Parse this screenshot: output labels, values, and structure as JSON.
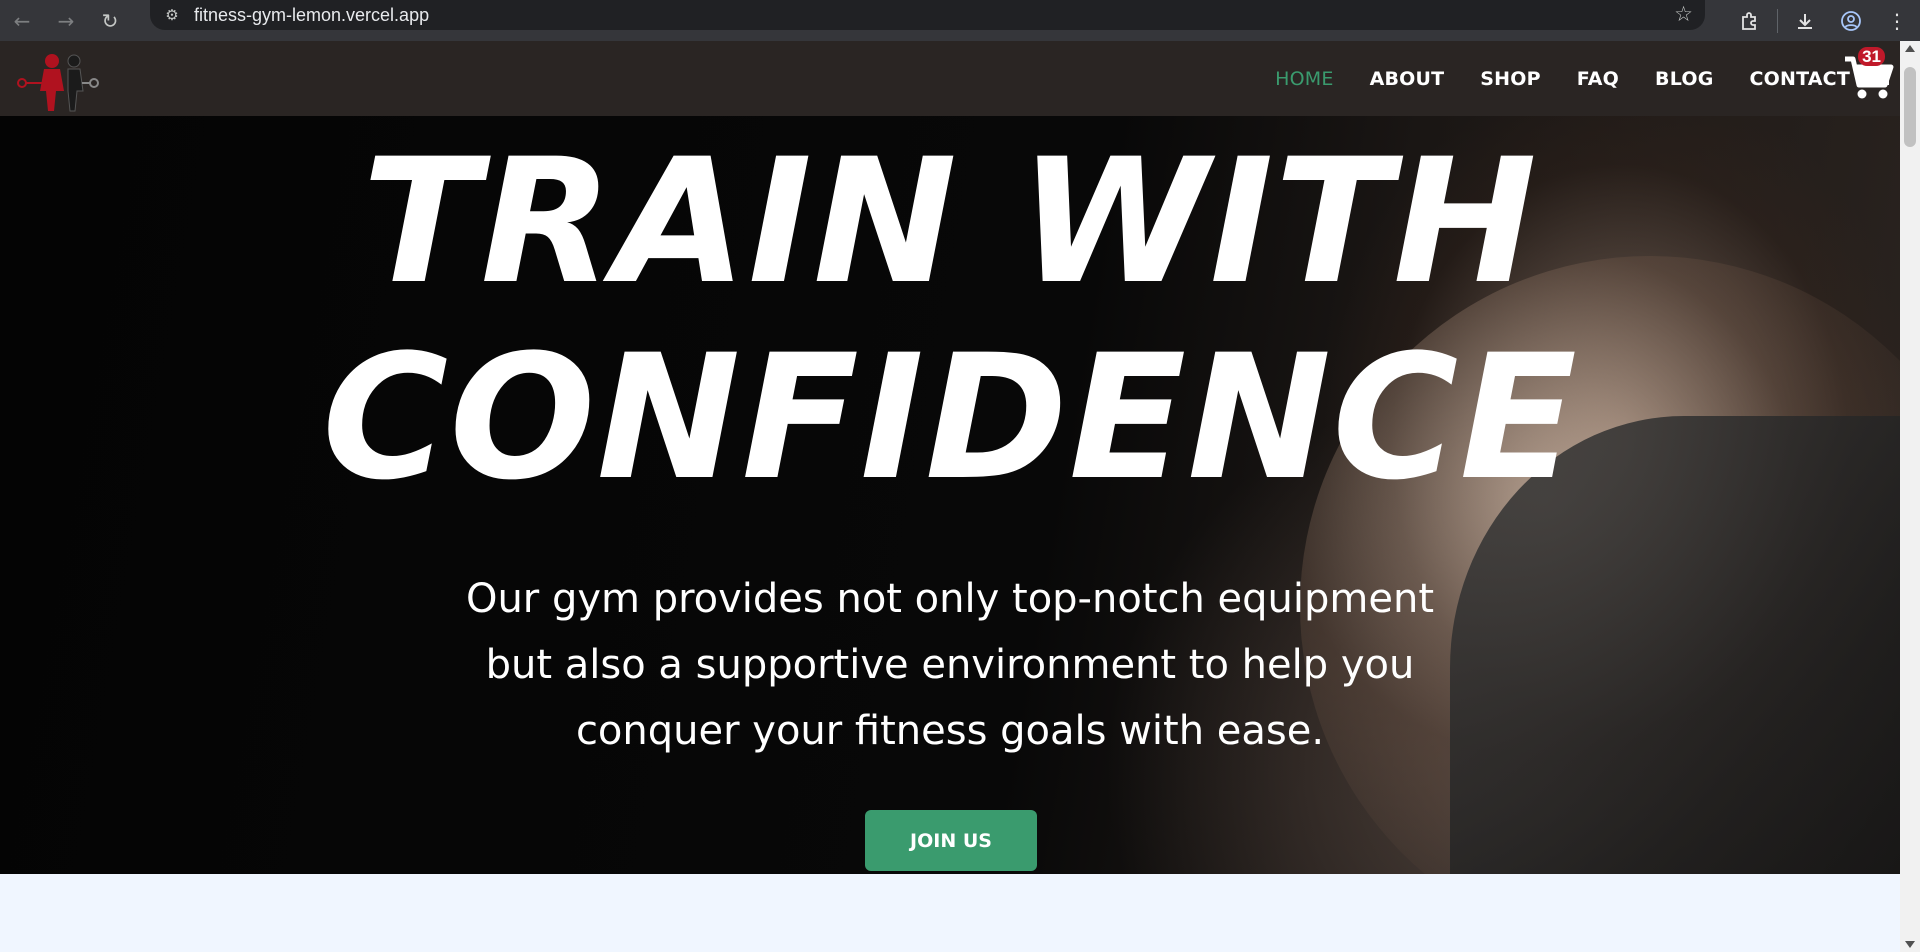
{
  "browser": {
    "url": "fitness-gym-lemon.vercel.app",
    "icons": [
      "back-icon",
      "forward-icon",
      "reload-icon",
      "site-info-icon",
      "bookmark-star-icon",
      "extensions-icon",
      "download-icon",
      "profile-icon",
      "menu-icon"
    ]
  },
  "header": {
    "nav": [
      {
        "label": "HOME",
        "active": true
      },
      {
        "label": "ABOUT"
      },
      {
        "label": "SHOP"
      },
      {
        "label": "FAQ"
      },
      {
        "label": "BLOG"
      },
      {
        "label": "CONTACT"
      }
    ],
    "cart_count": "31"
  },
  "hero": {
    "title_line1": "TRAIN WITH",
    "title_line2": "CONFIDENCE",
    "description": "Our gym provides not only top-notch equipment but also a supportive environment to help you conquer your fitness goals with ease.",
    "cta_label": "JOIN US"
  },
  "colors": {
    "accent": "#3a9b6e",
    "header_bg": "#2a2523",
    "badge": "#c0192a"
  }
}
